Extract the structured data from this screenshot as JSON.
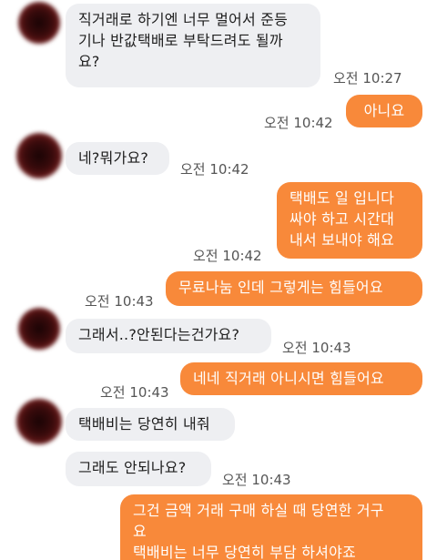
{
  "messages": [
    {
      "side": "in",
      "text": "직거래로 하기엔 너무 멀어서 준등\n기나 반값택배로 부탁드려도 될까\n요?",
      "time": "오전 10:27"
    },
    {
      "side": "out",
      "text": "아니요",
      "time": "오전 10:42"
    },
    {
      "side": "in",
      "text": "네?뭐가요?",
      "time": "오전 10:42"
    },
    {
      "side": "out",
      "text": "택배도 일 입니다\n싸야 하고 시간대\n내서 보내야 해요",
      "time": "오전 10:42"
    },
    {
      "side": "out",
      "text": "무료나눔 인데 그렇게는 힘들어요",
      "time": "오전 10:43"
    },
    {
      "side": "in",
      "text": "그래서..?안된다는건가요?",
      "time": "오전 10:43"
    },
    {
      "side": "out",
      "text": "네네 직거래 아니시면 힘들어요",
      "time": "오전 10:43"
    },
    {
      "side": "in",
      "text": "택배비는 당연히 내줘"
    },
    {
      "side": "in",
      "text": "그래도 안되나요?",
      "time": "오전 10:43"
    },
    {
      "side": "out",
      "text": "그건 금액 거래 구매 하실 때 당연한 거구\n요\n택배비는 너무 당연히 부담 하셔야죠"
    }
  ]
}
